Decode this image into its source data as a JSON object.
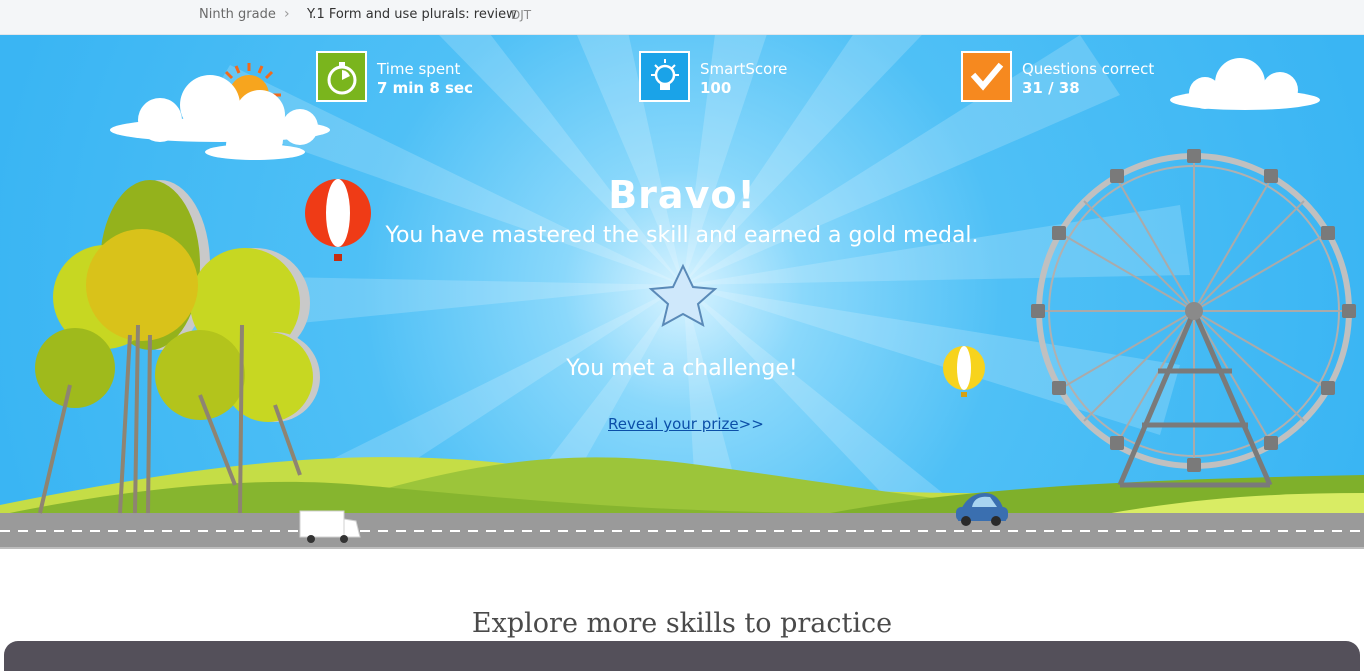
{
  "breadcrumb": {
    "grade": "Ninth grade",
    "skill": "Y.1 Form and use plurals: review",
    "code": "DJT"
  },
  "stats": {
    "time": {
      "label": "Time spent",
      "value": "7 min 8 sec",
      "color": "#7ab51d",
      "icon": "stopwatch-icon"
    },
    "smartscore": {
      "label": "SmartScore",
      "value": "100",
      "color": "#1aa3e8",
      "icon": "lightbulb-icon"
    },
    "questions": {
      "label": "Questions correct",
      "value": "31 / 38",
      "color": "#f6891f",
      "icon": "checkmark-icon"
    }
  },
  "message": {
    "headline": "Bravo!",
    "subtitle": "You have mastered the skill and earned a gold medal.",
    "challenge": "You met a challenge!",
    "prize_link": "Reveal your prize",
    "prize_arrows": ">>"
  },
  "explore": {
    "title": "Explore more skills to practice"
  },
  "colors": {
    "sky": "#3ab5f3",
    "hill": "#9cc53a",
    "road": "#9a9a9a",
    "link": "#0b4fa8"
  }
}
